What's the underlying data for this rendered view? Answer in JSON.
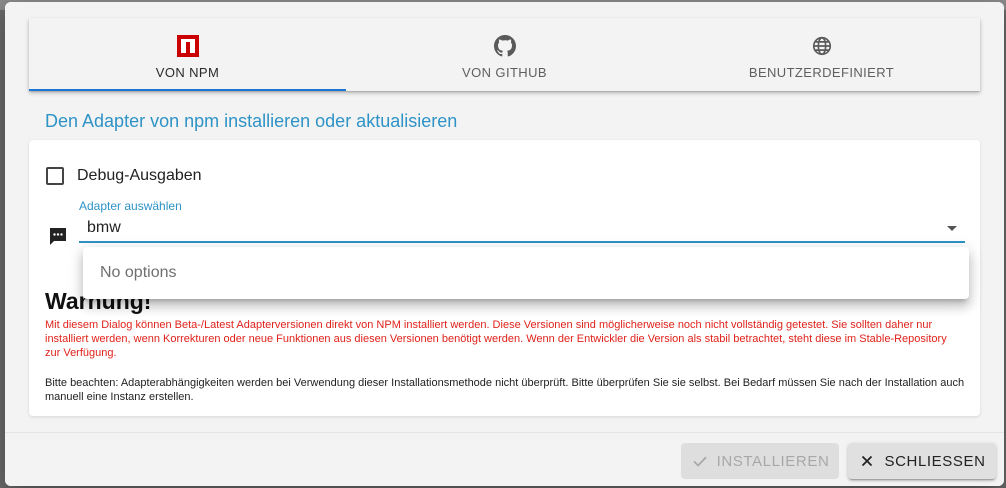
{
  "tabs": [
    {
      "label": "VON NPM",
      "icon": "npm-icon",
      "active": true
    },
    {
      "label": "VON GITHUB",
      "icon": "github-icon",
      "active": false
    },
    {
      "label": "BENUTZERDEFINIERT",
      "icon": "globe-icon",
      "active": false
    }
  ],
  "heading": "Den Adapter von npm installieren oder aktualisieren",
  "debug": {
    "label": "Debug-Ausgaben",
    "checked": false
  },
  "adapter_select": {
    "label": "Adapter auswählen",
    "value": "bmw",
    "no_options": "No options"
  },
  "warning": {
    "title": "Warnung!",
    "text": "Mit diesem Dialog können Beta-/Latest Adapterversionen direkt von NPM installiert werden. Diese Versionen sind möglicherweise noch nicht vollständig getestet. Sie sollten daher nur installiert werden, wenn Korrekturen oder neue Funktionen aus diesen Versionen benötigt werden. Wenn der Entwickler die Version als stabil betrachtet, steht diese im Stable-Repository zur Verfügung."
  },
  "note": "Bitte beachten: Adapterabhängigkeiten werden bei Verwendung dieser Installationsmethode nicht überprüft. Bitte überprüfen Sie sie selbst. Bei Bedarf müssen Sie nach der Installation auch manuell eine Instanz erstellen.",
  "buttons": {
    "install": "INSTALLIEREN",
    "close": "SCHLIESSEN"
  },
  "colors": {
    "accent": "#2e93c6",
    "tab_indicator": "#1976d2",
    "warning": "#e0221b",
    "npm_red": "#cb0000"
  }
}
